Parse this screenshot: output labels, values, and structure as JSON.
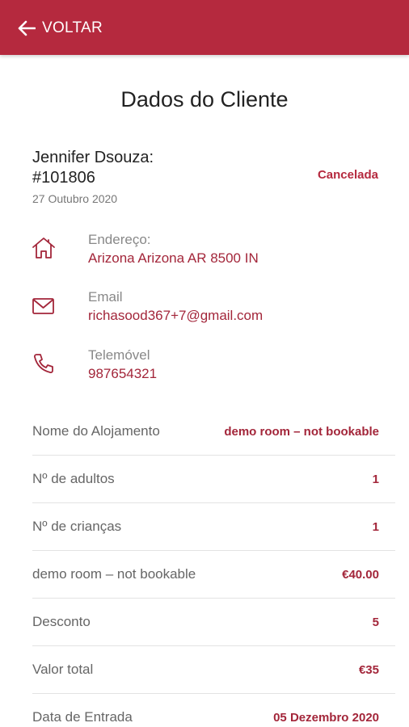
{
  "header": {
    "back_label": "VOLTAR"
  },
  "page": {
    "title": "Dados do Cliente"
  },
  "customer": {
    "name": "Jennifer Dsouza:",
    "booking_id": "#101806",
    "date": "27 Outubro 2020",
    "status": "Cancelada"
  },
  "contact": [
    {
      "icon": "home-icon",
      "label": "Endereço:",
      "value": "Arizona Arizona AR 8500 IN"
    },
    {
      "icon": "mail-icon",
      "label": "Email",
      "value": "richasood367+7@gmail.com"
    },
    {
      "icon": "phone-icon",
      "label": "Telemóvel",
      "value": "987654321"
    }
  ],
  "details": [
    {
      "label": "Nome do Alojamento",
      "value": "demo room – not bookable"
    },
    {
      "label": "Nº de adultos",
      "value": "1"
    },
    {
      "label": "Nº de crianças",
      "value": "1"
    },
    {
      "label": "demo room – not bookable",
      "value": "€40.00"
    },
    {
      "label": "Desconto",
      "value": "5"
    },
    {
      "label": "Valor total",
      "value": "€35"
    },
    {
      "label": "Data de Entrada",
      "value": "05 Dezembro 2020"
    }
  ],
  "colors": {
    "brand": "#b5293e",
    "accent_text": "#a3263a"
  }
}
